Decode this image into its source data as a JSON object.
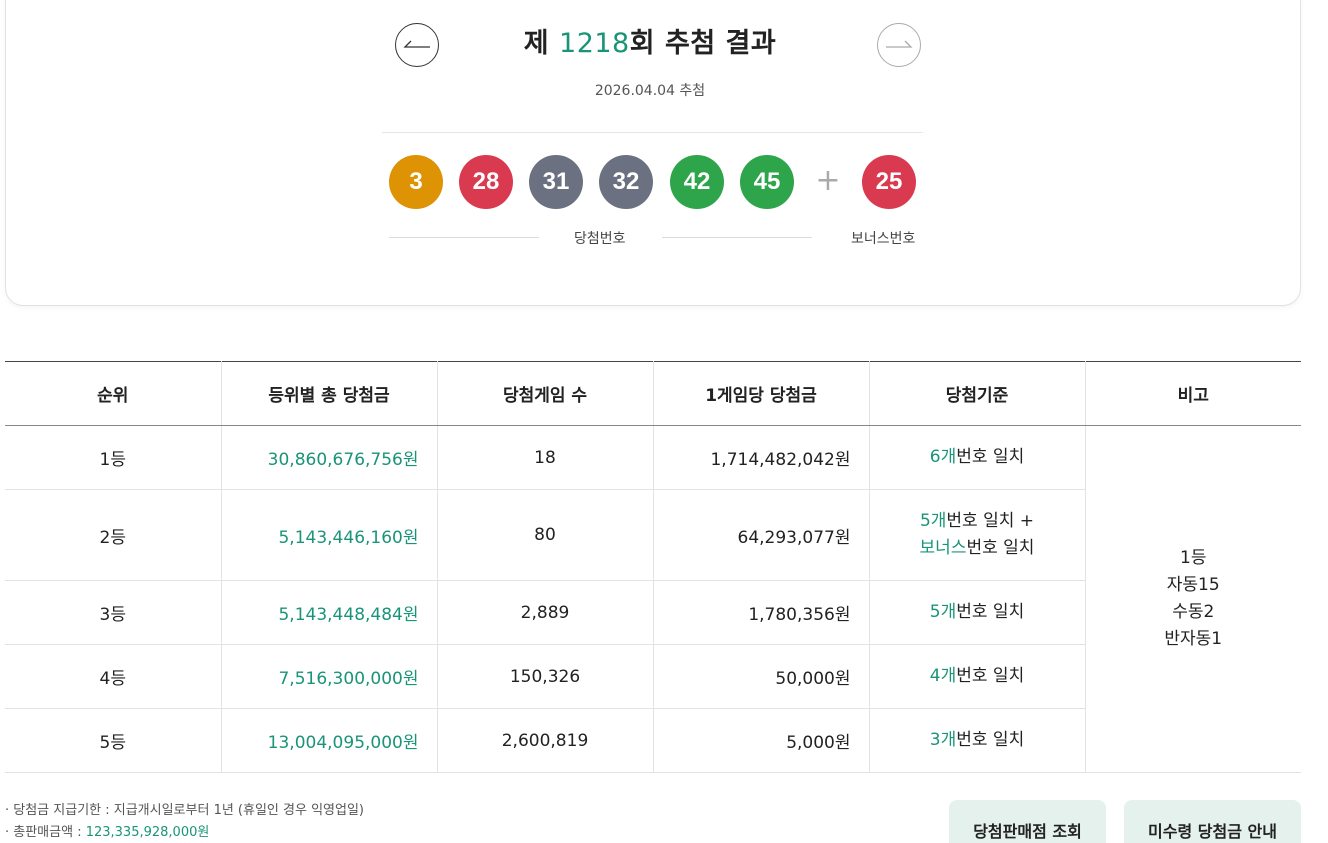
{
  "draw": {
    "title_prefix": "제 ",
    "round": "1218",
    "title_suffix": "회 추첨 결과",
    "date": "2026.04.04 추첨",
    "winning_label": "당첨번호",
    "bonus_label": "보너스번호",
    "plus": "+",
    "numbers": [
      {
        "value": "3",
        "color": "#dd9304"
      },
      {
        "value": "28",
        "color": "#da3a4f"
      },
      {
        "value": "31",
        "color": "#6b7180"
      },
      {
        "value": "32",
        "color": "#6b7180"
      },
      {
        "value": "42",
        "color": "#2ea44b"
      },
      {
        "value": "45",
        "color": "#2ea44b"
      }
    ],
    "bonus": {
      "value": "25",
      "color": "#da3a4f"
    },
    "icons": {
      "prev": "arrow-left-icon",
      "next": "arrow-right-icon"
    }
  },
  "table": {
    "headers": [
      "순위",
      "등위별 총 당첨금",
      "당첨게임 수",
      "1게임당 당첨금",
      "당첨기준",
      "비고"
    ],
    "rows": [
      {
        "rank": "1등",
        "total": "30,860,676,756원",
        "games": "18",
        "per_game": "1,714,482,042원",
        "crit_num": "6개",
        "crit_text": "번호 일치"
      },
      {
        "rank": "2등",
        "total": "5,143,446,160원",
        "games": "80",
        "per_game": "64,293,077원",
        "crit_num": "5개",
        "crit_text": "번호 일치 +",
        "crit_bonus": "보너스",
        "crit_bonus_text": "번호 일치"
      },
      {
        "rank": "3등",
        "total": "5,143,448,484원",
        "games": "2,889",
        "per_game": "1,780,356원",
        "crit_num": "5개",
        "crit_text": "번호 일치"
      },
      {
        "rank": "4등",
        "total": "7,516,300,000원",
        "games": "150,326",
        "per_game": "50,000원",
        "crit_num": "4개",
        "crit_text": "번호 일치"
      },
      {
        "rank": "5등",
        "total": "13,004,095,000원",
        "games": "2,600,819",
        "per_game": "5,000원",
        "crit_num": "3개",
        "crit_text": "번호 일치"
      }
    ],
    "remark": [
      "1등",
      "자동15",
      "수동2",
      "반자동1"
    ]
  },
  "notes": {
    "deadline": "· 당첨금 지급기한 : 지급개시일로부터 1년 (휴일인 경우 익영업일)",
    "sales_label": "· 총판매금액 : ",
    "sales_amount": "123,335,928,000원"
  },
  "buttons": {
    "store": "당첨판매점 조회",
    "unclaimed": "미수령 당첨금 안내"
  }
}
